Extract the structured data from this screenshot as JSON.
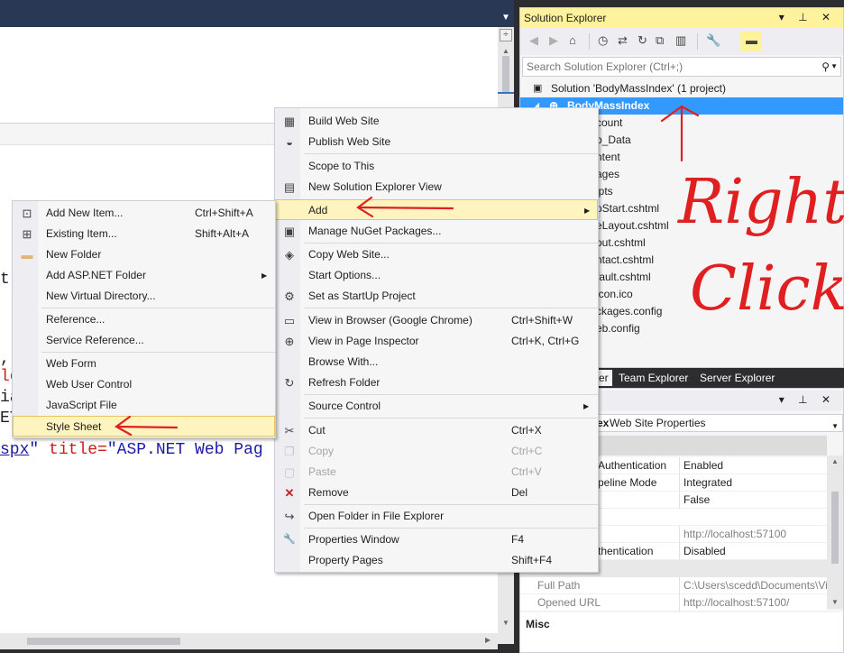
{
  "editor": {
    "line_t": "t",
    "line_comma": ",",
    "line_le": "le",
    "line_ia": "ia",
    "line_et": "ET",
    "line_last": {
      "link": "spx",
      "q1": "\"",
      "attr": " title=",
      "val": "\"ASP.NET Web Pag"
    }
  },
  "solution_explorer": {
    "title": "Solution Explorer",
    "title_buttons": "▾ ⊥ ✕",
    "search_placeholder": "Search Solution Explorer (Ctrl+;)",
    "tree": [
      {
        "label": "Solution 'BodyMassIndex' (1 project)"
      },
      {
        "label": "BodyMassIndex"
      },
      {
        "label": "count"
      },
      {
        "label": "p_Data"
      },
      {
        "label": "ntent"
      },
      {
        "label": "ages"
      },
      {
        "label": "ipts"
      },
      {
        "label": "pStart.cshtml"
      },
      {
        "label": "eLayout.cshtml"
      },
      {
        "label": "out.cshtml"
      },
      {
        "label": "ntact.cshtml"
      },
      {
        "label": "fault.cshtml"
      },
      {
        "label": "icon.ico"
      },
      {
        "label": "ckages.config"
      },
      {
        "label": "eb.config"
      }
    ],
    "tabs": [
      {
        "label": "er"
      },
      {
        "label": "Team Explorer"
      },
      {
        "label": "Server Explorer"
      }
    ]
  },
  "properties": {
    "title_buttons": "▾ ⊥ ✕",
    "object_bold": "ex",
    "object_rest": " Web Site Properties",
    "rows": [
      {
        "name": "Authentication",
        "value": "Enabled"
      },
      {
        "name": "peline Mode",
        "value": "Integrated"
      },
      {
        "name": "",
        "value": "False"
      },
      {
        "name": "",
        "value": ""
      },
      {
        "name": "",
        "value": "http://localhost:57100"
      },
      {
        "name": "thentication",
        "value": "Disabled"
      }
    ],
    "rows2": [
      {
        "name": "Full Path",
        "value": "C:\\Users\\scedd\\Documents\\Vi"
      },
      {
        "name": "Opened URL",
        "value": "http://localhost:57100/"
      }
    ],
    "desc_title": "Misc"
  },
  "main_menu": {
    "items": [
      {
        "label": "Build Web Site",
        "icon": "build-icon",
        "glyph": "▦"
      },
      {
        "label": "Publish Web Site",
        "icon": "publish-icon",
        "glyph": "◒"
      },
      {
        "label": "Scope to This",
        "icon": "",
        "glyph": ""
      },
      {
        "label": "New Solution Explorer View",
        "icon": "new-view-icon",
        "glyph": "▤"
      },
      {
        "label": "Add",
        "icon": "",
        "glyph": ""
      },
      {
        "label": "Manage NuGet Packages...",
        "icon": "nuget-icon",
        "glyph": "▣"
      },
      {
        "label": "Copy Web Site...",
        "icon": "copy-site-icon",
        "glyph": "◈"
      },
      {
        "label": "Start Options...",
        "icon": "",
        "glyph": ""
      },
      {
        "label": "Set as StartUp Project",
        "icon": "gear-icon",
        "glyph": "⚙"
      },
      {
        "label": "View in Browser (Google Chrome)",
        "shortcut": "Ctrl+Shift+W",
        "icon": "browser-icon",
        "glyph": "▭"
      },
      {
        "label": "View in Page Inspector",
        "shortcut": "Ctrl+K, Ctrl+G",
        "icon": "inspector-icon",
        "glyph": "⊕"
      },
      {
        "label": "Browse With...",
        "icon": "",
        "glyph": ""
      },
      {
        "label": "Refresh Folder",
        "icon": "refresh-icon",
        "glyph": "↻"
      },
      {
        "label": "Source Control",
        "icon": "",
        "glyph": ""
      },
      {
        "label": "Cut",
        "shortcut": "Ctrl+X",
        "icon": "scissors-icon",
        "glyph": "✂"
      },
      {
        "label": "Copy",
        "shortcut": "Ctrl+C",
        "icon": "copy-icon",
        "glyph": "❐"
      },
      {
        "label": "Paste",
        "shortcut": "Ctrl+V",
        "icon": "paste-icon",
        "glyph": "▢"
      },
      {
        "label": "Remove",
        "shortcut": "Del",
        "icon": "remove-icon",
        "glyph": "✕"
      },
      {
        "label": "Open Folder in File Explorer",
        "icon": "open-folder-icon",
        "glyph": "↪"
      },
      {
        "label": "Properties Window",
        "shortcut": "F4",
        "icon": "wrench-icon",
        "glyph": "🔧"
      },
      {
        "label": "Property Pages",
        "shortcut": "Shift+F4",
        "icon": "",
        "glyph": ""
      }
    ]
  },
  "add_menu": {
    "items": [
      {
        "label": "Add New Item...",
        "shortcut": "Ctrl+Shift+A",
        "icon": "new-item-icon",
        "glyph": "⊡"
      },
      {
        "label": "Existing Item...",
        "shortcut": "Shift+Alt+A",
        "icon": "existing-item-icon",
        "glyph": "⊞"
      },
      {
        "label": "New Folder",
        "icon": "folder-icon",
        "glyph": "▬"
      },
      {
        "label": "Add ASP.NET Folder",
        "icon": "",
        "glyph": ""
      },
      {
        "label": "New Virtual Directory...",
        "icon": "",
        "glyph": ""
      },
      {
        "label": "Reference...",
        "icon": "",
        "glyph": ""
      },
      {
        "label": "Service Reference...",
        "icon": "",
        "glyph": ""
      },
      {
        "label": "Web Form",
        "icon": "",
        "glyph": ""
      },
      {
        "label": "Web User Control",
        "icon": "",
        "glyph": ""
      },
      {
        "label": "JavaScript File",
        "icon": "",
        "glyph": ""
      },
      {
        "label": "Style Sheet",
        "icon": "",
        "glyph": ""
      }
    ]
  },
  "annotation": {
    "line1": "Right",
    "line2": "Click",
    "color": "#e02020"
  }
}
